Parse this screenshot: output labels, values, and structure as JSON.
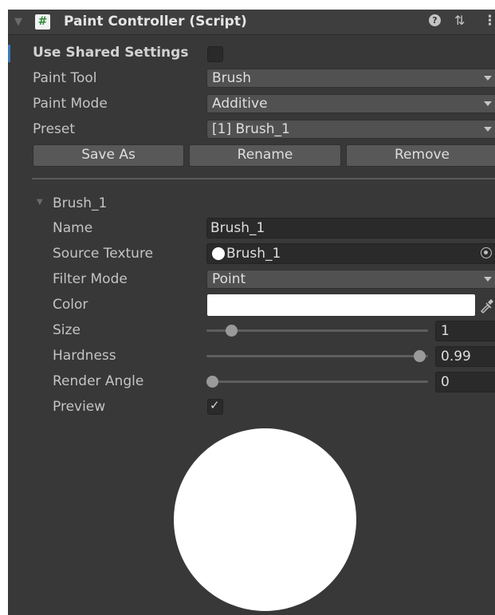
{
  "header": {
    "title": "Paint Controller (Script)",
    "script_glyph": "#",
    "collapse_arrow": "▼",
    "help_glyph": "?",
    "presets_glyph": "⇅",
    "more_glyph": "⋮"
  },
  "settings": {
    "use_shared_label": "Use Shared Settings",
    "use_shared_checked": false,
    "paint_tool_label": "Paint Tool",
    "paint_tool_value": "Brush",
    "paint_mode_label": "Paint Mode",
    "paint_mode_value": "Additive",
    "preset_label": "Preset",
    "preset_value": "[1] Brush_1"
  },
  "buttons": {
    "save_as": "Save As",
    "rename": "Rename",
    "remove": "Remove"
  },
  "brush": {
    "foldout_label": "Brush_1",
    "foldout_arrow": "▼",
    "name_label": "Name",
    "name_value": "Brush_1",
    "source_texture_label": "Source Texture",
    "source_texture_value": "Brush_1",
    "filter_mode_label": "Filter Mode",
    "filter_mode_value": "Point",
    "color_label": "Color",
    "color_value": "#ffffff",
    "size_label": "Size",
    "size_value": "1",
    "size_fraction": 0.09,
    "hardness_label": "Hardness",
    "hardness_value": "0.99",
    "hardness_fraction": 0.99,
    "render_angle_label": "Render Angle",
    "render_angle_value": "0",
    "render_angle_fraction": 0.0,
    "preview_label": "Preview",
    "preview_checked": true,
    "check_glyph": "✓"
  },
  "colors": {
    "panel_bg": "#383838",
    "header_bg": "#3e3e3e",
    "accent": "#3a79bb",
    "script_icon": "#2e8b3a"
  }
}
